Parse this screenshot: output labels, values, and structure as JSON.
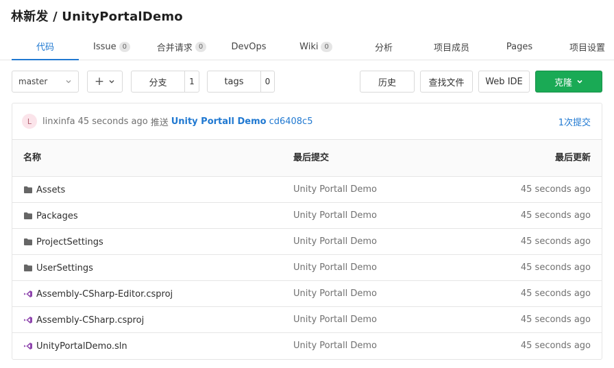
{
  "header": {
    "title": "林新发 / UnityPortalDemo"
  },
  "tabs": [
    {
      "label": "代码",
      "count": ""
    },
    {
      "label": "Issue",
      "count": "0"
    },
    {
      "label": "合并请求",
      "count": "0"
    },
    {
      "label": "DevOps",
      "count": ""
    },
    {
      "label": "Wiki",
      "count": "0"
    },
    {
      "label": "分析",
      "count": ""
    },
    {
      "label": "项目成员",
      "count": ""
    },
    {
      "label": "Pages",
      "count": ""
    },
    {
      "label": "项目设置",
      "count": ""
    }
  ],
  "toolbar": {
    "branch": "master",
    "add": "+",
    "branches_label": "分支",
    "branches_count": "1",
    "tags_label": "tags",
    "tags_count": "0",
    "history": "历史",
    "find_file": "查找文件",
    "web_ide": "Web IDE",
    "clone": "克隆"
  },
  "last_commit": {
    "avatar_letter": "L",
    "author": "linxinfa",
    "time": "45 seconds ago",
    "action": "推送",
    "message": "Unity Portall Demo",
    "sha": "cd6408c5",
    "count": "1次提交"
  },
  "table": {
    "headers": {
      "name": "名称",
      "last_commit": "最后提交",
      "last_update": "最后更新"
    },
    "rows": [
      {
        "icon": "folder-icon",
        "name": "Assets",
        "commit": "Unity Portall Demo",
        "updated": "45 seconds ago"
      },
      {
        "icon": "folder-icon",
        "name": "Packages",
        "commit": "Unity Portall Demo",
        "updated": "45 seconds ago"
      },
      {
        "icon": "folder-icon",
        "name": "ProjectSettings",
        "commit": "Unity Portall Demo",
        "updated": "45 seconds ago"
      },
      {
        "icon": "folder-icon",
        "name": "UserSettings",
        "commit": "Unity Portall Demo",
        "updated": "45 seconds ago"
      },
      {
        "icon": "visual-studio-icon",
        "name": "Assembly-CSharp-Editor.csproj",
        "commit": "Unity Portall Demo",
        "updated": "45 seconds ago"
      },
      {
        "icon": "visual-studio-icon",
        "name": "Assembly-CSharp.csproj",
        "commit": "Unity Portall Demo",
        "updated": "45 seconds ago"
      },
      {
        "icon": "visual-studio-icon",
        "name": "UnityPortalDemo.sln",
        "commit": "Unity Portall Demo",
        "updated": "45 seconds ago"
      }
    ]
  },
  "colors": {
    "accent": "#1f78d1",
    "clone_button": "#1aaa55",
    "vs_icon": "#8e44ad",
    "folder_icon": "#666666"
  }
}
